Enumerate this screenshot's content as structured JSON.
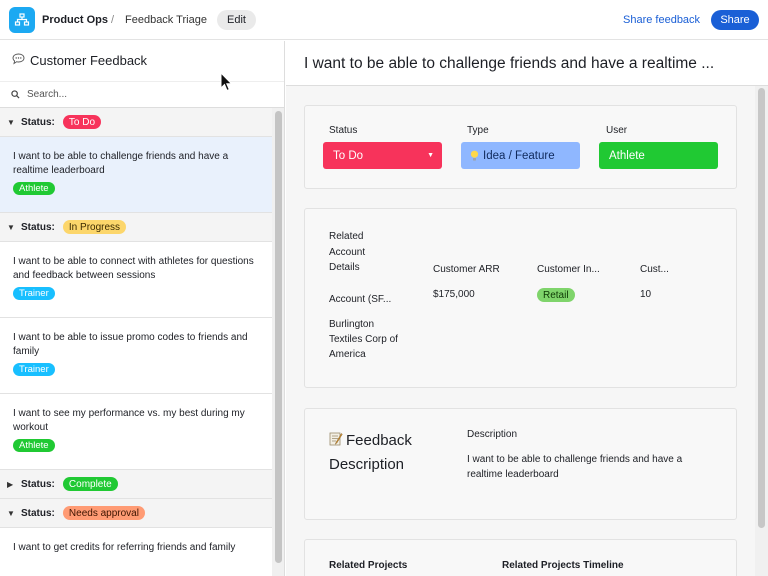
{
  "header": {
    "base_name": "Product Ops",
    "separator": "/",
    "page_name": "Feedback Triage",
    "edit_label": "Edit",
    "share_feedback_label": "Share feedback",
    "share_label": "Share"
  },
  "left_panel": {
    "title": "Customer Feedback",
    "search_placeholder": "Search...",
    "status_label": "Status:",
    "groups": [
      {
        "status": "To Do",
        "pill_bg": "#f7335b",
        "pill_fg": "#ffffff",
        "expanded": true,
        "items": [
          {
            "text": "I want to be able to challenge friends and have a realtime leaderboard",
            "tag": "Athlete",
            "tag_color": "#20c933",
            "selected": true
          }
        ]
      },
      {
        "status": "In Progress",
        "pill_bg": "#fcd66b",
        "pill_fg": "#3b2a00",
        "expanded": true,
        "items": [
          {
            "text": "I want to be able to connect with athletes for questions and feedback between sessions",
            "tag": "Trainer",
            "tag_color": "#18bfff",
            "selected": false
          },
          {
            "text": "I want to be able to issue promo codes to friends and family",
            "tag": "Trainer",
            "tag_color": "#18bfff",
            "selected": false
          },
          {
            "text": "I want to see my performance vs. my best during my workout",
            "tag": "Athlete",
            "tag_color": "#20c933",
            "selected": false
          }
        ]
      },
      {
        "status": "Complete",
        "pill_bg": "#20c933",
        "pill_fg": "#ffffff",
        "expanded": false,
        "items": []
      },
      {
        "status": "Needs approval",
        "pill_bg": "#ff9b74",
        "pill_fg": "#3d1400",
        "expanded": true,
        "items": [
          {
            "text": "I want to get credits for referring friends and family",
            "tag": "",
            "tag_color": "#20c933",
            "selected": false
          }
        ]
      }
    ]
  },
  "detail": {
    "title": "I want to be able to challenge friends and have a realtime ...",
    "fields": {
      "status_label": "Status",
      "status_value": "To Do",
      "type_label": "Type",
      "type_value": "Idea / Feature",
      "user_label": "User",
      "user_value": "Athlete"
    },
    "related_account": {
      "section_label": "Related Account Details",
      "account_header": "Account (SF...",
      "account_value": "Burlington Textiles Corp of America",
      "arr_header": "Customer ARR",
      "arr_value": "$175,000",
      "industry_header": "Customer In...",
      "industry_value": "Retail",
      "cust_header": "Cust...",
      "cust_value": "10"
    },
    "feedback": {
      "section_label": "Feedback Description",
      "desc_label": "Description",
      "desc_value": "I want to be able to challenge friends and have a realtime leaderboard"
    },
    "projects": {
      "related_projects_label": "Related Projects",
      "timeline_label": "Related Projects Timeline"
    }
  },
  "colors": {
    "accent": "#1a5fd6",
    "status_todo": "#f7335b",
    "type_idea": "#8fb7ff",
    "user_athlete": "#20c933",
    "retail": "#7fd46b"
  }
}
